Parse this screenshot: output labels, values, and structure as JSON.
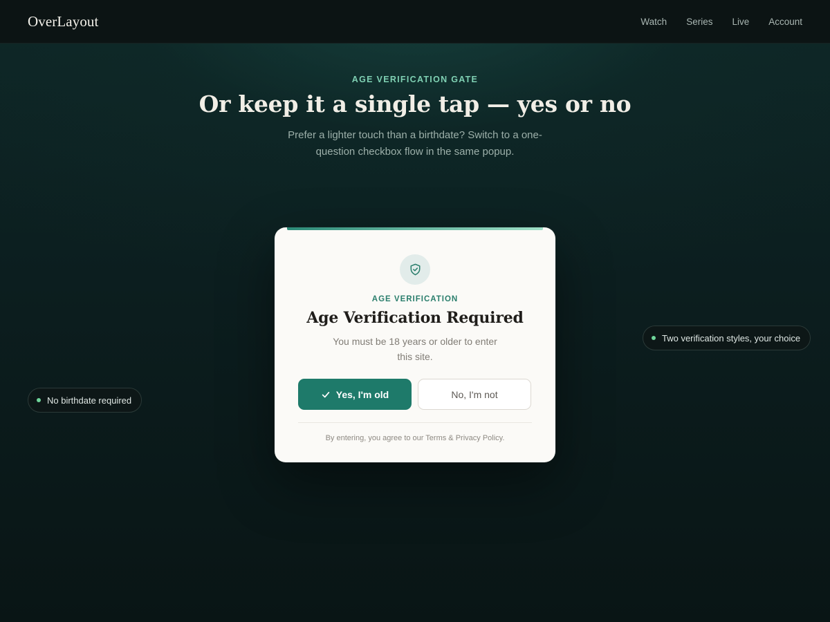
{
  "header": {
    "brand": "OverLayout",
    "nav": [
      "Watch",
      "Series",
      "Live",
      "Account"
    ]
  },
  "hero": {
    "eyebrow": "AGE VERIFICATION GATE",
    "title": "Or keep it a single tap — yes or no",
    "subtitle": "Prefer a lighter touch than a birthdate? Switch to a one-question checkbox flow in the same popup."
  },
  "pills": {
    "left": "No birthdate required",
    "right": "Two verification styles, your choice"
  },
  "modal": {
    "icon": "shield-check-icon",
    "eyebrow": "AGE VERIFICATION",
    "title": "Age Verification Required",
    "description": "You must be 18 years or older to enter this site.",
    "yes_label": "Yes, I'm old",
    "no_label": "No, I'm not",
    "legal": "By entering, you agree to our Terms & Privacy Policy."
  },
  "colors": {
    "accent": "#1e7a6a",
    "eyebrow_accent": "#7fd0b3",
    "pill_dot": "#6fd59a"
  }
}
